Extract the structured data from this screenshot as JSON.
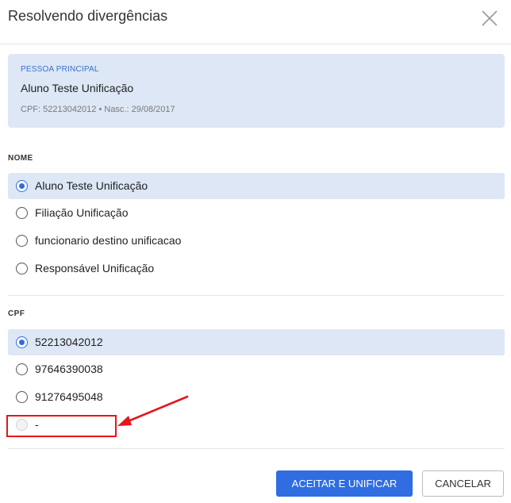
{
  "dialog": {
    "title": "Resolvendo divergências",
    "close_icon": "close-icon"
  },
  "principal": {
    "kicker": "PESSOA PRINCIPAL",
    "name": "Aluno Teste Unificação",
    "meta": "CPF: 52213042012 • Nasc.: 29/08/2017"
  },
  "nome": {
    "label": "NOME",
    "options": [
      {
        "label": "Aluno Teste Unificação",
        "selected": true
      },
      {
        "label": "Filiação Unificação",
        "selected": false
      },
      {
        "label": "funcionario destino unificacao",
        "selected": false
      },
      {
        "label": "Responsável Unificação",
        "selected": false
      }
    ]
  },
  "cpf": {
    "label": "CPF",
    "options": [
      {
        "label": "52213042012",
        "selected": true
      },
      {
        "label": "97646390038",
        "selected": false
      },
      {
        "label": "91276495048",
        "selected": false
      },
      {
        "label": "-",
        "selected": false,
        "disabled": true
      }
    ]
  },
  "annotation": {
    "color": "#e8141b"
  },
  "footer": {
    "accept_label": "ACEITAR E UNIFICAR",
    "cancel_label": "CANCELAR"
  },
  "colors": {
    "accent": "#2f6de1",
    "selected_bg": "#dde7f6",
    "kicker": "#3b6fc9"
  }
}
